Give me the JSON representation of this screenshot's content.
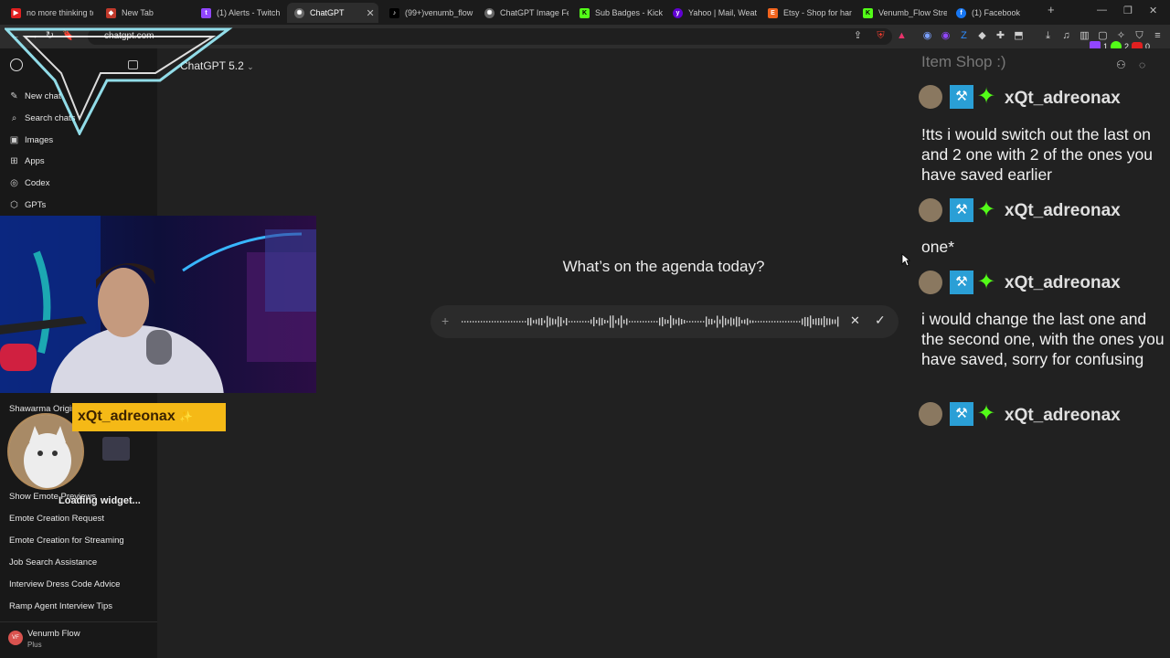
{
  "tabs": [
    {
      "label": "no more thinking to",
      "color": "#e02020",
      "icon": "youtube-icon"
    },
    {
      "label": "New Tab",
      "color": "#c0392b",
      "icon": "brave-icon"
    },
    {
      "label": "(1) Alerts - Twitch",
      "color": "#9146ff",
      "icon": "twitch-icon"
    },
    {
      "label": "ChatGPT",
      "color": "#888888",
      "icon": "chatgpt-icon"
    },
    {
      "label": "(99+)venumb_flow",
      "color": "#000000",
      "icon": "tiktok-icon"
    },
    {
      "label": "ChatGPT Image Feb",
      "color": "#888888",
      "icon": "chatgpt-icon"
    },
    {
      "label": "Sub Badges - Kick D",
      "color": "#53fc18",
      "icon": "kick-icon"
    },
    {
      "label": "Yahoo | Mail, Weath",
      "color": "#6001d2",
      "icon": "yahoo-icon"
    },
    {
      "label": "Etsy - Shop for han",
      "color": "#f1641e",
      "icon": "etsy-icon"
    },
    {
      "label": "Venumb_Flow Strea",
      "color": "#53fc18",
      "icon": "kick-icon"
    },
    {
      "label": "(1) Facebook",
      "color": "#1877f2",
      "icon": "facebook-icon"
    }
  ],
  "address": {
    "url": "chatgpt.com"
  },
  "extensions": {
    "count_a": "1",
    "count_b": "2",
    "count_c": "0"
  },
  "sidebar": {
    "items": [
      {
        "label": "New chat",
        "icon": "edit-icon"
      },
      {
        "label": "Search chats",
        "icon": "search-icon"
      },
      {
        "label": "Images",
        "icon": "image-icon"
      },
      {
        "label": "Apps",
        "icon": "apps-icon"
      },
      {
        "label": "Codex",
        "icon": "codex-icon"
      },
      {
        "label": "GPTs",
        "icon": "gpts-icon"
      }
    ],
    "history": [
      "Shawarma Origin",
      "Show Emote Previews",
      "Emote Creation Request",
      "Emote Creation for Streaming",
      "Job Search Assistance",
      "Interview Dress Code Advice",
      "Ramp Agent Interview Tips"
    ],
    "user": {
      "name": "Venumb Flow",
      "plan": "Plus",
      "initials": "VF"
    }
  },
  "main": {
    "model": "ChatGPT 5.2",
    "greeting": "What’s on the agenda today?"
  },
  "overlay": {
    "alert_name": "xQt_adreonax",
    "loading": "Loading widget...",
    "chat_header": "Item Shop :)",
    "chat": [
      {
        "user": "xQt_adreonax",
        "message": "!tts i would switch out the last on and 2 one with 2 of the ones you have saved earlier"
      },
      {
        "user": "xQt_adreonax",
        "message": "one*"
      },
      {
        "user": "xQt_adreonax",
        "message": "i would change the last one and the second one, with the ones you have saved, sorry for confusing"
      },
      {
        "user": "xQt_adreonax",
        "message": ""
      }
    ]
  }
}
